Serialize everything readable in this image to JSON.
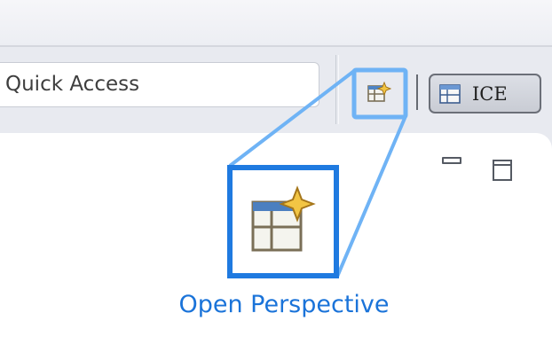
{
  "toolbar": {
    "quick_access_placeholder": "Quick Access",
    "open_perspective_tooltip": "Open Perspective",
    "perspectives": [
      {
        "label": "ICE",
        "active": true
      }
    ]
  },
  "callout": {
    "caption": "Open Perspective",
    "icon": "open-perspective-icon",
    "highlight_color": "#1f7ae0"
  },
  "colors": {
    "accent": "#1f7ae0",
    "caption_text": "#1a73d9",
    "toolbar_bg": "#e8eaf0"
  }
}
